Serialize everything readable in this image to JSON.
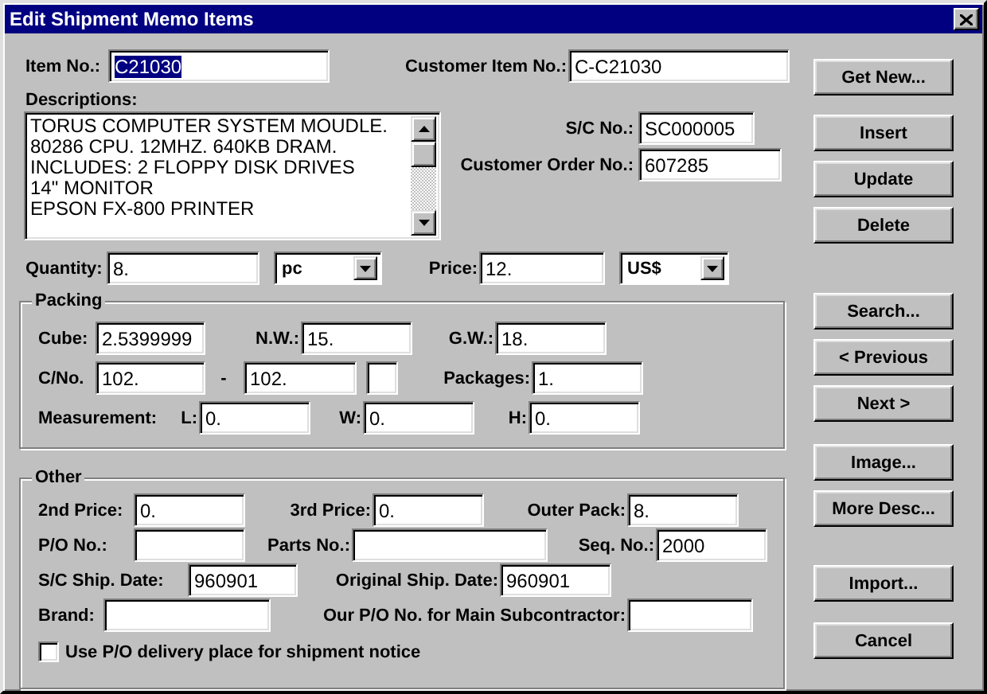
{
  "window": {
    "title": "Edit Shipment Memo Items"
  },
  "item_row": [
    {
      "label": "Item No.:",
      "value": "C21030",
      "highlighted": true
    },
    {
      "label": "Customer Item No.:",
      "value": "C-C21030",
      "highlighted": false
    }
  ],
  "descriptions": {
    "label": "Descriptions:",
    "lines": [
      "TORUS COMPUTER SYSTEM MOUDLE.",
      "80286 CPU. 12MHZ. 640KB DRAM.",
      "INCLUDES: 2 FLOPPY DISK DRIVES",
      "14\" MONITOR",
      "EPSON FX-800 PRINTER"
    ]
  },
  "order_fields": [
    {
      "label": "S/C No.:",
      "value": "SC000005"
    },
    {
      "label": "Customer Order No.:",
      "value": "607285"
    }
  ],
  "quantity_row": [
    {
      "kind": "field",
      "label": "Quantity:",
      "value": "8."
    },
    {
      "kind": "select",
      "value": "pc"
    },
    {
      "kind": "field",
      "label": "Price:",
      "value": "12."
    },
    {
      "kind": "select",
      "value": "US$"
    }
  ],
  "packing": {
    "title": "Packing",
    "weights": [
      {
        "kind": "field",
        "label": "Cube:",
        "value": "2.5399999"
      },
      {
        "kind": "field",
        "label": "N.W.:",
        "value": "15."
      },
      {
        "kind": "field",
        "label": "G.W.:",
        "value": "18."
      }
    ],
    "cartons": [
      {
        "kind": "field",
        "label": "C/No.",
        "value": "102."
      },
      {
        "kind": "separator",
        "text": "-"
      },
      {
        "kind": "field",
        "value": "102."
      },
      {
        "kind": "field"
      },
      {
        "kind": "field",
        "label": "Packages:",
        "value": "1."
      }
    ],
    "measurement": [
      {
        "kind": "label",
        "label": "Measurement:"
      },
      {
        "kind": "field",
        "label": "L:",
        "value": "0."
      },
      {
        "kind": "field",
        "label": "W:",
        "value": "0."
      },
      {
        "kind": "field",
        "label": "H:",
        "value": "0."
      }
    ]
  },
  "other": {
    "title": "Other",
    "rows": [
      [
        {
          "kind": "field",
          "label": "2nd Price:",
          "value": "0."
        },
        {
          "kind": "field",
          "label": "3rd Price:",
          "value": "0."
        },
        {
          "kind": "field",
          "label": "Outer Pack:",
          "value": "8."
        }
      ],
      [
        {
          "kind": "field",
          "label": "P/O No.:"
        },
        {
          "kind": "field",
          "label": "Parts No.:"
        },
        {
          "kind": "field",
          "label": "Seq. No.:",
          "value": "2000"
        }
      ],
      [
        {
          "kind": "field",
          "label": "S/C Ship. Date:",
          "value": "960901"
        },
        {
          "kind": "field",
          "label": "Original Ship. Date:",
          "value": "960901"
        }
      ],
      [
        {
          "kind": "field",
          "label": "Brand:"
        },
        {
          "kind": "field",
          "label": "Our P/O No. for Main Subcontractor:"
        }
      ]
    ],
    "checkbox": {
      "label": "Use P/O delivery place for shipment notice",
      "checked": false
    }
  },
  "buttons": [
    {
      "label": "Get New..."
    },
    {
      "label": "Insert"
    },
    {
      "label": "Update"
    },
    {
      "label": "Delete"
    },
    {
      "label": "Search..."
    },
    {
      "label": "< Previous"
    },
    {
      "label": "Next >"
    },
    {
      "label": "Image..."
    },
    {
      "label": "More Desc..."
    },
    {
      "label": "Import..."
    },
    {
      "label": "Cancel"
    }
  ]
}
